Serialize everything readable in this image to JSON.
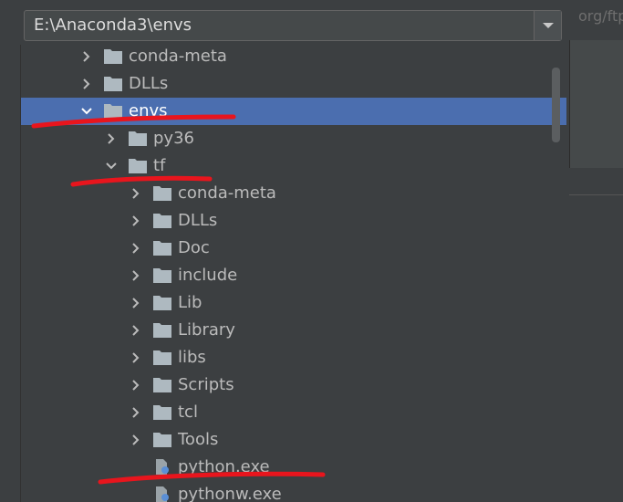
{
  "background": {
    "url_fragment": "org/ftp"
  },
  "path_field": {
    "value": "E:\\Anaconda3\\envs",
    "dropdown_icon": "chevron-down-icon"
  },
  "tree": {
    "items": [
      {
        "label": "conda-meta",
        "level": 0,
        "expanded": false,
        "type": "folder"
      },
      {
        "label": "DLLs",
        "level": 0,
        "expanded": false,
        "type": "folder"
      },
      {
        "label": "envs",
        "level": 0,
        "expanded": true,
        "type": "folder",
        "selected": true
      },
      {
        "label": "py36",
        "level": 1,
        "expanded": false,
        "type": "folder"
      },
      {
        "label": "tf",
        "level": 1,
        "expanded": true,
        "type": "folder"
      },
      {
        "label": "conda-meta",
        "level": 2,
        "expanded": false,
        "type": "folder"
      },
      {
        "label": "DLLs",
        "level": 2,
        "expanded": false,
        "type": "folder"
      },
      {
        "label": "Doc",
        "level": 2,
        "expanded": false,
        "type": "folder"
      },
      {
        "label": "include",
        "level": 2,
        "expanded": false,
        "type": "folder"
      },
      {
        "label": "Lib",
        "level": 2,
        "expanded": false,
        "type": "folder"
      },
      {
        "label": "Library",
        "level": 2,
        "expanded": false,
        "type": "folder"
      },
      {
        "label": "libs",
        "level": 2,
        "expanded": false,
        "type": "folder"
      },
      {
        "label": "Scripts",
        "level": 2,
        "expanded": false,
        "type": "folder"
      },
      {
        "label": "tcl",
        "level": 2,
        "expanded": false,
        "type": "folder"
      },
      {
        "label": "Tools",
        "level": 2,
        "expanded": false,
        "type": "folder"
      },
      {
        "label": "python.exe",
        "level": 2,
        "type": "file"
      },
      {
        "label": "pythonw.exe",
        "level": 2,
        "type": "file"
      }
    ]
  },
  "colors": {
    "selection": "#4b6eaf",
    "annotation": "#e8151d",
    "folder": "#aeb9c0"
  }
}
